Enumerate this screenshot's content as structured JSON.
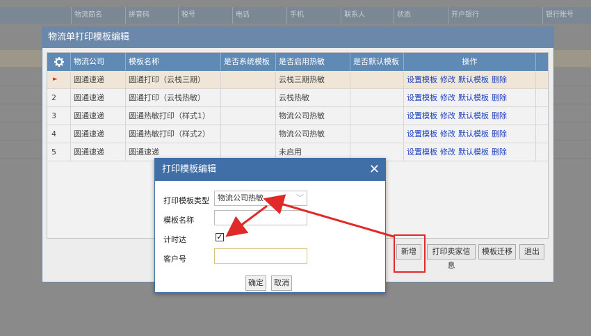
{
  "background": {
    "columns": [
      "物流简名",
      "拼音码",
      "税号",
      "电话",
      "手机",
      "联系人",
      "状态",
      "开户银行",
      "银行账号"
    ]
  },
  "main_modal": {
    "title": "物流单打印模板编辑",
    "gear_icon": "gear-icon",
    "headers": [
      "物流公司",
      "模板名称",
      "是否系统模板",
      "是否启用热敏",
      "是否默认模板",
      "操作"
    ],
    "rows": [
      {
        "index": "►",
        "company": "圆通速递",
        "template": "圆通打印（云栈三期）",
        "system": "",
        "thermal": "云栈三期热敏",
        "default": ""
      },
      {
        "index": "2",
        "company": "圆通速递",
        "template": "圆通打印（云栈热敏）",
        "system": "",
        "thermal": "云栈热敏",
        "default": ""
      },
      {
        "index": "3",
        "company": "圆通速递",
        "template": "圆通热敏打印（样式1）",
        "system": "",
        "thermal": "物流公司热敏",
        "default": ""
      },
      {
        "index": "4",
        "company": "圆通速递",
        "template": "圆通热敏打印（样式2）",
        "system": "",
        "thermal": "物流公司热敏",
        "default": ""
      },
      {
        "index": "5",
        "company": "圆通速递",
        "template": "圆通速递",
        "system": "",
        "thermal": "未启用",
        "default": ""
      }
    ],
    "ops": {
      "set": "设置模板",
      "edit": "修改",
      "default": "默认模板",
      "delete": "删除"
    },
    "buttons": {
      "add": "新增",
      "print_seller": "打印卖家信息",
      "migrate": "模板迁移",
      "exit": "退出"
    }
  },
  "dialog": {
    "title": "打印模板编辑",
    "close": "✕",
    "type_label": "打印模板类型",
    "type_value": "物流公司热敏",
    "name_label": "模板名称",
    "name_value": "",
    "timer_label": "计时达",
    "timer_checked": "✓",
    "customer_label": "客户号",
    "customer_value": "",
    "ok": "确定",
    "cancel": "取消"
  },
  "colors": {
    "accent": "#3f6fa6",
    "grid_header": "#5f8ab5",
    "annotation": "#e02a2a",
    "link": "#1f3fbf"
  }
}
